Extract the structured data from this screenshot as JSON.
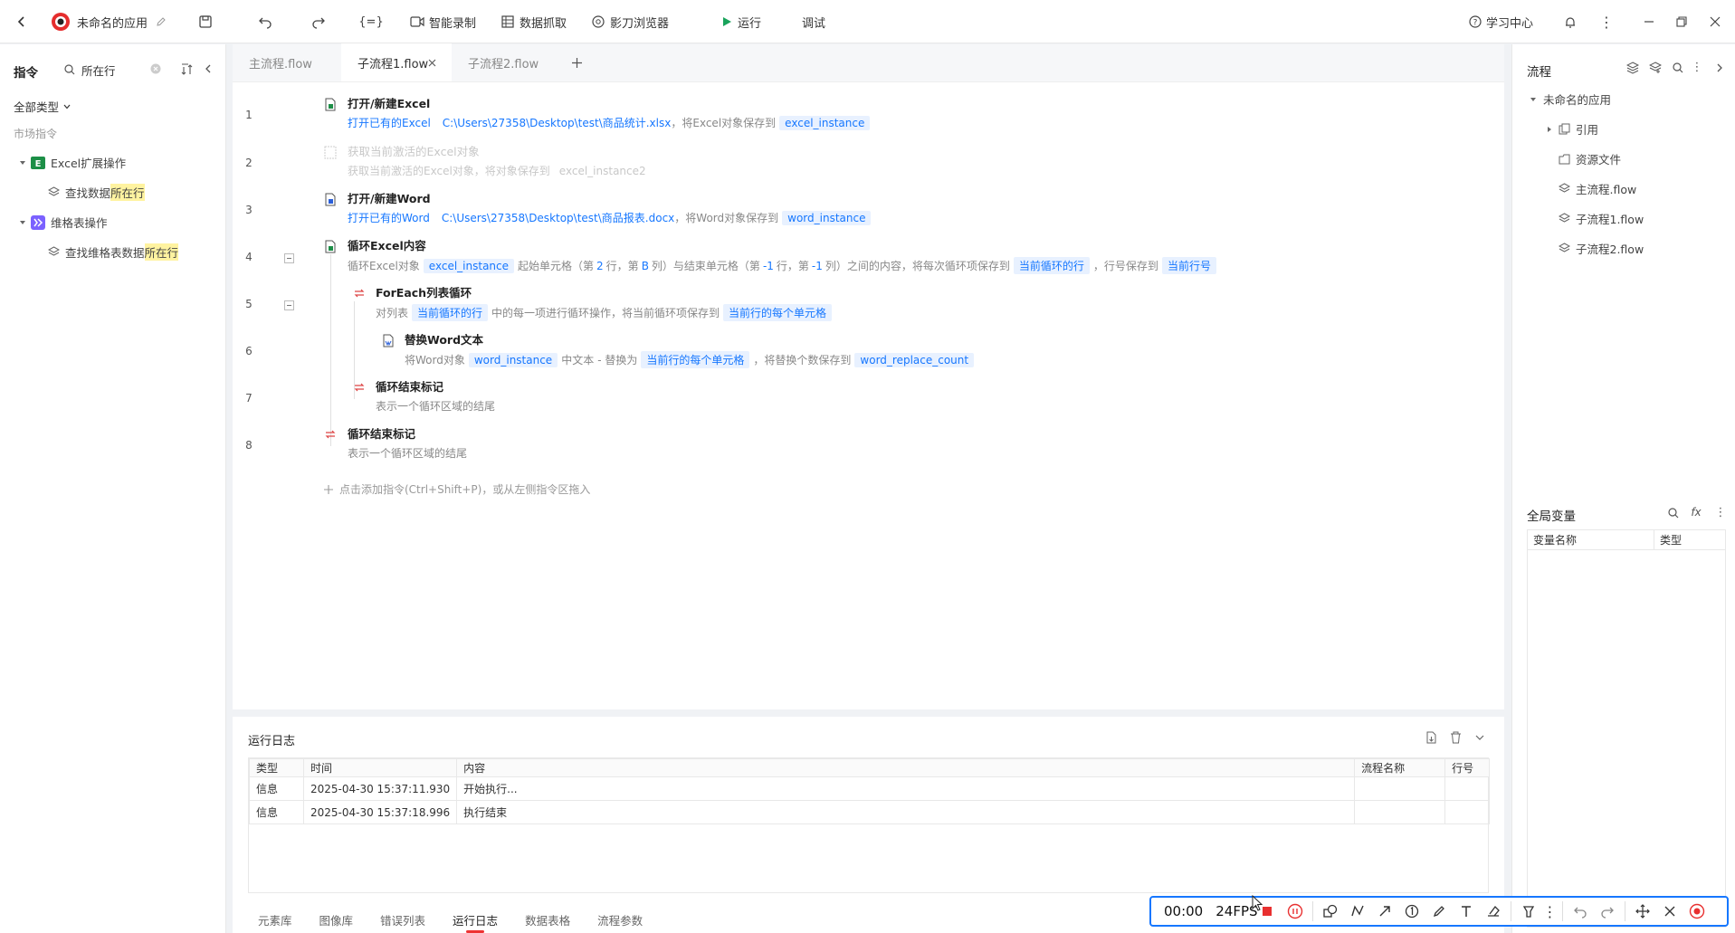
{
  "app": {
    "title": "未命名的应用",
    "toolbar": {
      "record": "智能录制",
      "scrape": "数据抓取",
      "browser": "影刀浏览器",
      "run": "运行",
      "debug": "调试",
      "learn": "学习中心"
    }
  },
  "left_panel": {
    "title": "指令",
    "search_value": "所在行",
    "filter": "全部类型",
    "market": "市场指令",
    "groups": [
      {
        "name": "Excel扩展操作",
        "item_prefix": "查找数据",
        "item_highlight": "所在行"
      },
      {
        "name": "维格表操作",
        "item_prefix": "查找维格表数据",
        "item_highlight": "所在行"
      }
    ]
  },
  "tabs": [
    {
      "label": "主流程.flow"
    },
    {
      "label": "子流程1.flow"
    },
    {
      "label": "子流程2.flow"
    }
  ],
  "flow": {
    "rows": [
      {
        "num": "1",
        "title": "打开/新建Excel",
        "d1": "打开已有的Excel",
        "d2": "C:\\Users\\27358\\Desktop\\test\\商品统计.xlsx",
        "d3": "，将Excel对象保存到",
        "v1": "excel_instance"
      },
      {
        "num": "2",
        "title": "获取当前激活的Excel对象",
        "d1": "获取当前激活的Excel对象，将对象保存到",
        "v1": "excel_instance2"
      },
      {
        "num": "3",
        "title": "打开/新建Word",
        "d1": "打开已有的Word",
        "d2": "C:\\Users\\27358\\Desktop\\test\\商品报表.docx",
        "d3": "，将Word对象保存到",
        "v1": "word_instance"
      },
      {
        "num": "4",
        "title": "循环Excel内容",
        "d1": "循环Excel对象",
        "v1": "excel_instance",
        "d2a": "起始单元格（第",
        "n1": "2",
        "d2b": "行，第",
        "n2": "B",
        "d2c": "列）与结束单元格（第",
        "n3": "-1",
        "d2d": "行，第",
        "n4": "-1",
        "d2e": "列）之间的内容，将每次循环项保存到",
        "v2": "当前循环的行",
        "d3": "，行号保存到",
        "v3": "当前行号"
      },
      {
        "num": "5",
        "title": "ForEach列表循环",
        "d1": "对列表",
        "v1": "当前循环的行",
        "d2": "中的每一项进行循环操作，将当前循环项保存到",
        "v2": "当前行的每个单元格"
      },
      {
        "num": "6",
        "title": "替换Word文本",
        "d1": "将Word对象",
        "v1": "word_instance",
        "d2": "中文本",
        "d2b": "- 替换为",
        "v2": "当前行的每个单元格",
        "d3": "，将替换个数保存到",
        "v3": "word_replace_count"
      },
      {
        "num": "7",
        "title": "循环结束标记",
        "d1": "表示一个循环区域的结尾"
      },
      {
        "num": "8",
        "title": "循环结束标记",
        "d1": "表示一个循环区域的结尾"
      }
    ],
    "add_hint": "点击添加指令(Ctrl+Shift+P)，或从左侧指令区拖入"
  },
  "right_panel": {
    "title": "流程",
    "root": "未命名的应用",
    "items": [
      "引用",
      "资源文件",
      "主流程.flow",
      "子流程1.flow",
      "子流程2.flow"
    ],
    "globals_title": "全局变量",
    "globals_cols": [
      "变量名称",
      "类型"
    ]
  },
  "log": {
    "title": "运行日志",
    "columns": [
      "类型",
      "时间",
      "内容",
      "流程名称",
      "行号"
    ],
    "rows": [
      [
        "信息",
        "2025-04-30 15:37:11.930",
        "开始执行...",
        "",
        ""
      ],
      [
        "信息",
        "2025-04-30 15:37:18.996",
        "执行结束",
        "",
        ""
      ]
    ],
    "bottom_tabs": [
      "元素库",
      "图像库",
      "错误列表",
      "运行日志",
      "数据表格",
      "流程参数"
    ]
  },
  "recorder": {
    "time": "00:00",
    "fps": "24FPS"
  },
  "colors": {
    "accent": "#1677ff",
    "run_green": "#19a35b",
    "highlight": "#fff3a0",
    "record_red": "#e83030"
  }
}
